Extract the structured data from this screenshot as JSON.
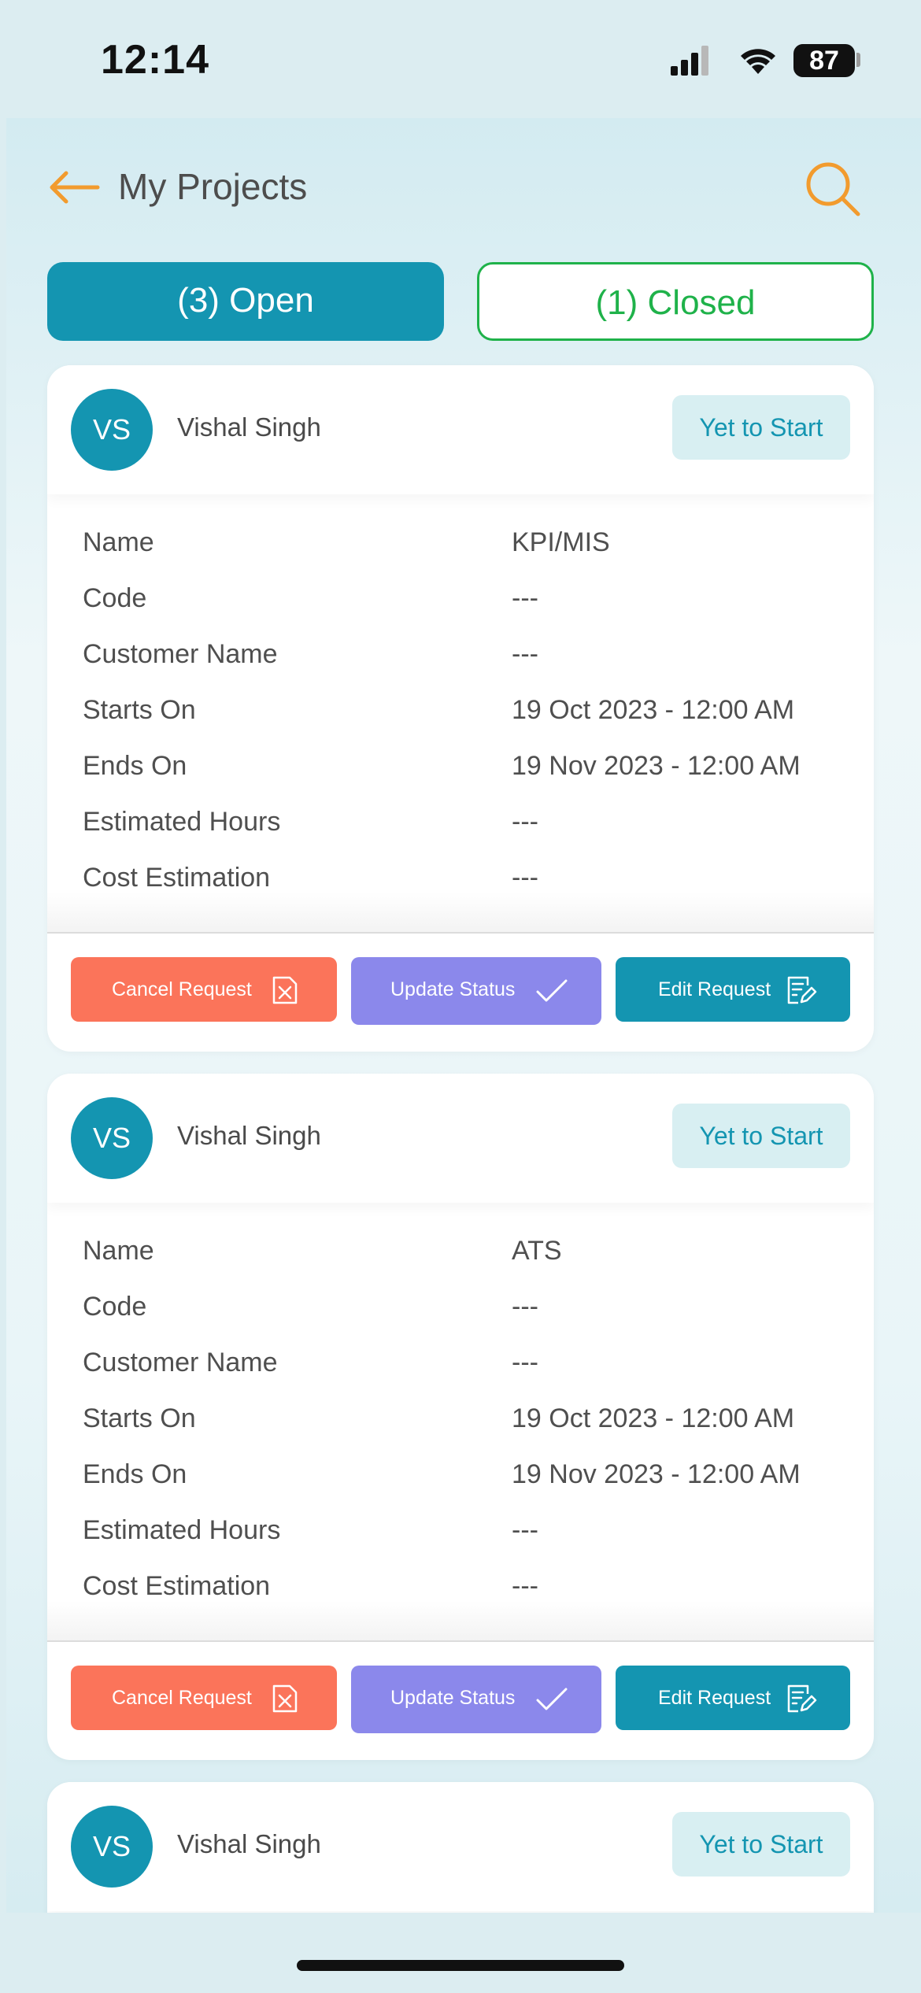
{
  "status_bar": {
    "time": "12:14",
    "battery": "87"
  },
  "header": {
    "title": "My Projects"
  },
  "tabs": {
    "open_label": "(3) Open",
    "closed_label": "(1) Closed"
  },
  "cards": [
    {
      "initials": "VS",
      "owner": "Vishal Singh",
      "status": "Yet to Start",
      "rows": [
        {
          "label": "Name",
          "value": "KPI/MIS"
        },
        {
          "label": "Code",
          "value": "---"
        },
        {
          "label": "Customer Name",
          "value": "---"
        },
        {
          "label": "Starts On",
          "value": "19 Oct 2023 - 12:00 AM"
        },
        {
          "label": "Ends On",
          "value": "19 Nov 2023 - 12:00 AM"
        },
        {
          "label": "Estimated Hours",
          "value": "---"
        },
        {
          "label": "Cost Estimation",
          "value": "---"
        }
      ],
      "actions": {
        "cancel": "Cancel Request",
        "update": "Update Status",
        "edit": "Edit Request"
      }
    },
    {
      "initials": "VS",
      "owner": "Vishal Singh",
      "status": "Yet to Start",
      "rows": [
        {
          "label": "Name",
          "value": "ATS"
        },
        {
          "label": "Code",
          "value": "---"
        },
        {
          "label": "Customer Name",
          "value": "---"
        },
        {
          "label": "Starts On",
          "value": "19 Oct 2023 - 12:00 AM"
        },
        {
          "label": "Ends On",
          "value": "19 Nov 2023 - 12:00 AM"
        },
        {
          "label": "Estimated Hours",
          "value": "---"
        },
        {
          "label": "Cost Estimation",
          "value": "---"
        }
      ],
      "actions": {
        "cancel": "Cancel Request",
        "update": "Update Status",
        "edit": "Edit Request"
      }
    },
    {
      "initials": "VS",
      "owner": "Vishal Singh",
      "status": "Yet to Start"
    }
  ],
  "colors": {
    "accent": "#1495b1",
    "closed_green": "#1fb24a",
    "back_arrow": "#f29b2e",
    "cancel": "#fb745a",
    "update": "#8b88eb",
    "edit": "#1495b1"
  }
}
